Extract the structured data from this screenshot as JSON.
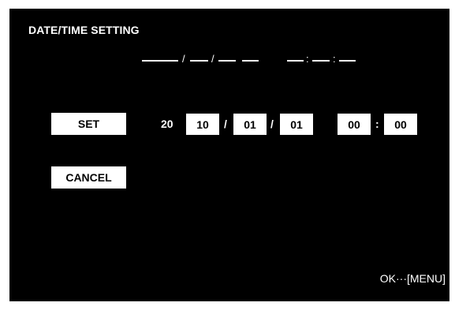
{
  "title": "DATE/TIME SETTING",
  "current_display": {
    "date_separator": "/",
    "time_separator": ":"
  },
  "set_button": "SET",
  "cancel_button": "CANCEL",
  "date_time_fields": {
    "century": "20",
    "year": "10",
    "date_sep_1": "/",
    "month": "01",
    "date_sep_2": "/",
    "day": "01",
    "hour": "00",
    "time_sep": ":",
    "minute": "00"
  },
  "footer_hint": "OK···[MENU]",
  "colors": {
    "background": "#000000",
    "foreground": "#ffffff"
  }
}
